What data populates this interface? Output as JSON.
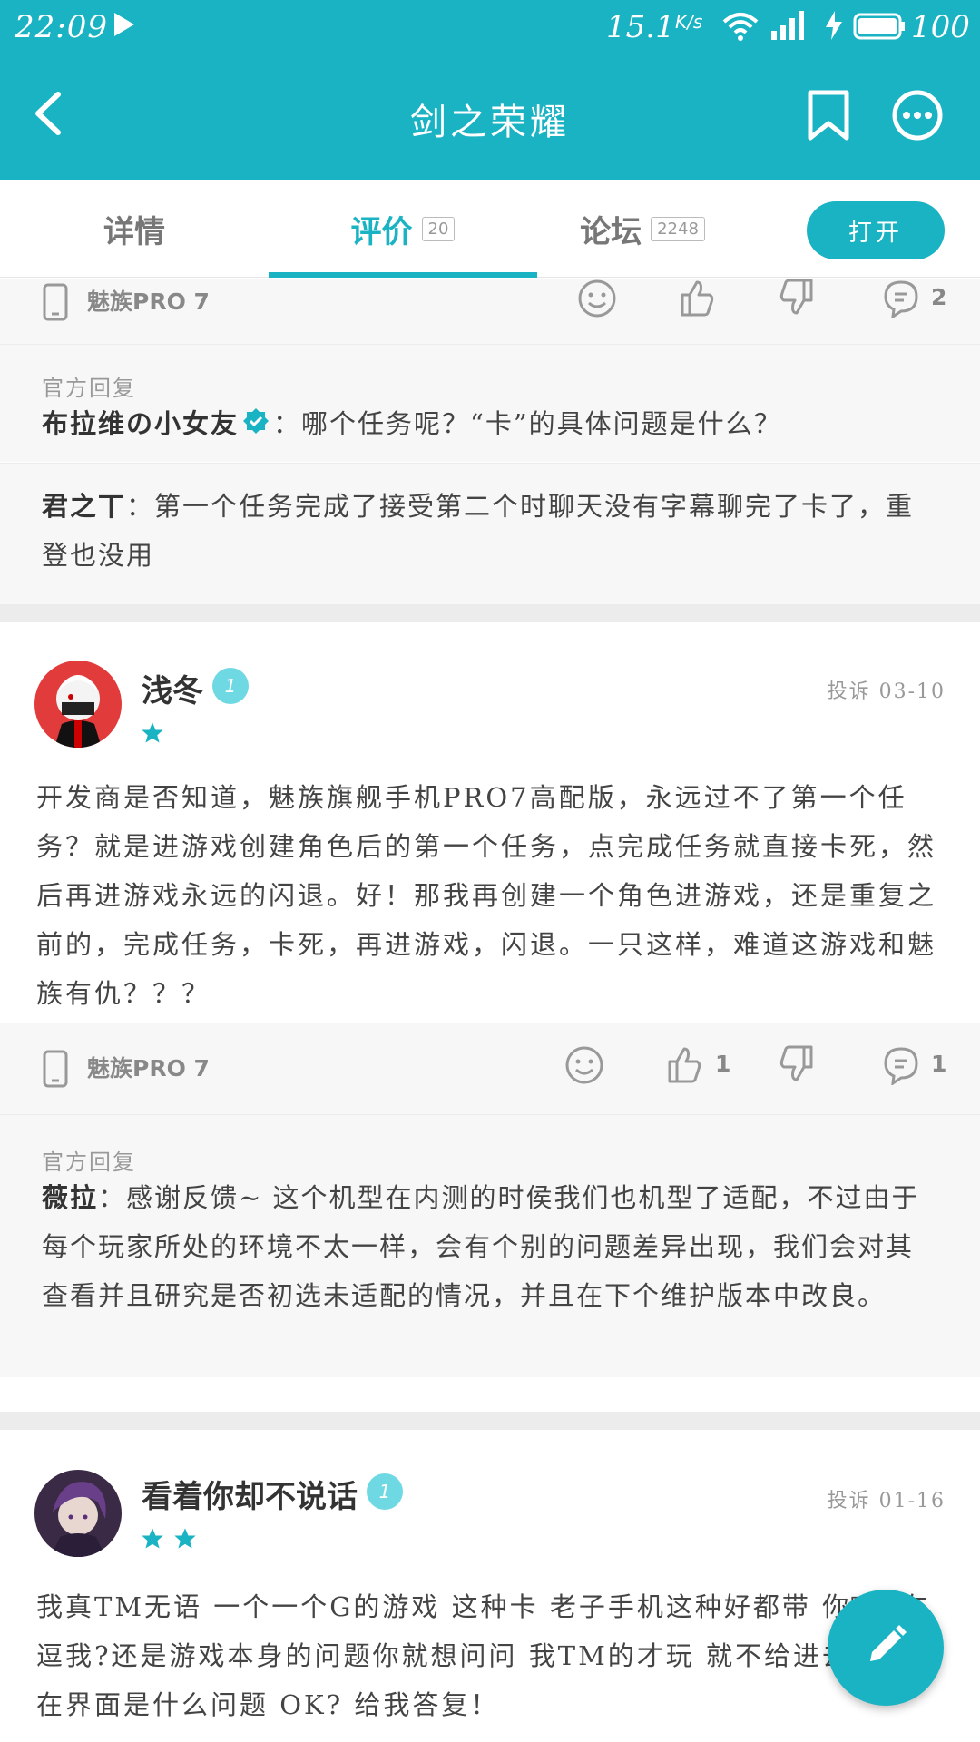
{
  "status_bar": {
    "time": "22:09",
    "net_speed": "15.1",
    "net_speed_unit": "K/s",
    "battery": "100"
  },
  "app_bar": {
    "title": "剑之荣耀"
  },
  "tabs": [
    {
      "label": "详情",
      "count": ""
    },
    {
      "label": "评价",
      "count": "20"
    },
    {
      "label": "论坛",
      "count": "2248"
    }
  ],
  "open_button": "打开",
  "colors": {
    "accent": "#1ab3c3",
    "level_badge": "#6fd9e3",
    "background_gray": "#f7f7f7"
  },
  "prev_review": {
    "device": "魅族PRO 7",
    "comments_count": "2",
    "reply_label": "官方回复",
    "reply_user": "布拉维の小女友",
    "reply_text": "：哪个任务呢？“卡”的具体问题是什么？",
    "followup_user": "君之丅",
    "followup_text": "：第一个任务完成了接受第二个时聊天没有字幕聊完了卡了，重登也没用"
  },
  "review1": {
    "user": "浅冬",
    "level": "1",
    "stars": 1,
    "meta": "投诉 03-10",
    "body": "开发商是否知道，魅族旗舰手机PRO7高配版，永远过不了第一个任务？就是进游戏创建角色后的第一个任务，点完成任务就直接卡死，然后再进游戏永远的闪退。好！那我再创建一个角色进游戏，还是重复之前的，完成任务，卡死，再进游戏，闪退。一只这样，难道这游戏和魅族有仇？？？",
    "device": "魅族PRO 7",
    "likes": "1",
    "comments": "1",
    "reply_label": "官方回复",
    "reply_user": "薇拉",
    "reply_text": "：感谢反馈~ 这个机型在内测的时侯我们也机型了适配，不过由于每个玩家所处的环境不太一样，会有个别的问题差异出现，我们会对其查看并且研究是否初选未适配的情况，并且在下个维护版本中改良。"
  },
  "review2": {
    "user": "看着你却不说话",
    "level": "1",
    "stars": 2,
    "meta": "投诉 01-16",
    "body": "我真TM无语 一个一个G的游戏 这种卡 老子手机这种好都带 你TM在逗我?还是游戏本身的问题你就想问问 我TM的才玩 就不给进去 一直在界面是什么问题 OK? 给我答复！"
  }
}
